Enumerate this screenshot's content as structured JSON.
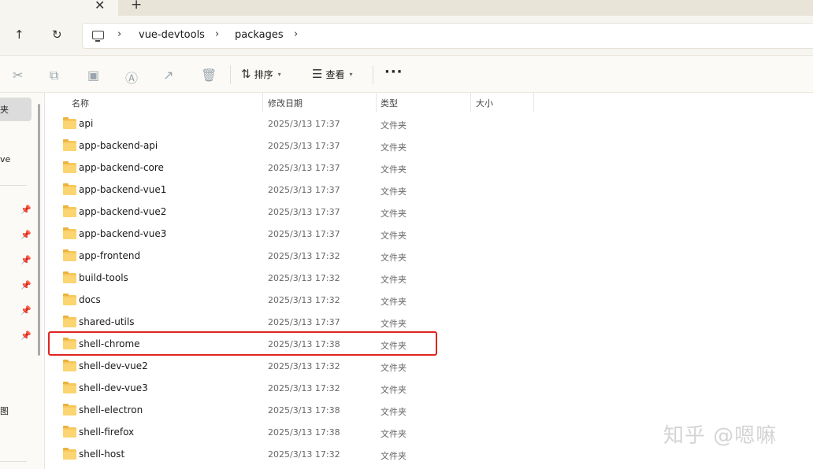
{
  "tabstrip": {
    "close_glyph": "✕",
    "new_glyph": "+"
  },
  "nav": {
    "back_icon": "↑",
    "refresh_icon": "↻"
  },
  "breadcrumb": {
    "items": [
      "vue-devtools",
      "packages"
    ],
    "separator": "›"
  },
  "toolbar": {
    "sort_label": "排序",
    "view_label": "查看",
    "more_label": "···"
  },
  "navpane": {
    "items": [
      "夹",
      "ve",
      "图"
    ]
  },
  "table": {
    "headers": {
      "name": "名称",
      "date": "修改日期",
      "type": "类型",
      "size": "大小"
    },
    "rows": [
      {
        "name": "api",
        "date": "2025/3/13 17:37",
        "type": "文件夹"
      },
      {
        "name": "app-backend-api",
        "date": "2025/3/13 17:37",
        "type": "文件夹"
      },
      {
        "name": "app-backend-core",
        "date": "2025/3/13 17:37",
        "type": "文件夹"
      },
      {
        "name": "app-backend-vue1",
        "date": "2025/3/13 17:37",
        "type": "文件夹"
      },
      {
        "name": "app-backend-vue2",
        "date": "2025/3/13 17:37",
        "type": "文件夹"
      },
      {
        "name": "app-backend-vue3",
        "date": "2025/3/13 17:37",
        "type": "文件夹"
      },
      {
        "name": "app-frontend",
        "date": "2025/3/13 17:32",
        "type": "文件夹"
      },
      {
        "name": "build-tools",
        "date": "2025/3/13 17:32",
        "type": "文件夹"
      },
      {
        "name": "docs",
        "date": "2025/3/13 17:32",
        "type": "文件夹"
      },
      {
        "name": "shared-utils",
        "date": "2025/3/13 17:37",
        "type": "文件夹"
      },
      {
        "name": "shell-chrome",
        "date": "2025/3/13 17:38",
        "type": "文件夹"
      },
      {
        "name": "shell-dev-vue2",
        "date": "2025/3/13 17:32",
        "type": "文件夹"
      },
      {
        "name": "shell-dev-vue3",
        "date": "2025/3/13 17:32",
        "type": "文件夹"
      },
      {
        "name": "shell-electron",
        "date": "2025/3/13 17:38",
        "type": "文件夹"
      },
      {
        "name": "shell-firefox",
        "date": "2025/3/13 17:38",
        "type": "文件夹"
      },
      {
        "name": "shell-host",
        "date": "2025/3/13 17:32",
        "type": "文件夹"
      }
    ]
  },
  "highlighted_row": "shell-chrome",
  "highlight_color": "#e0231f",
  "watermark": "知乎 @嗯嘛"
}
